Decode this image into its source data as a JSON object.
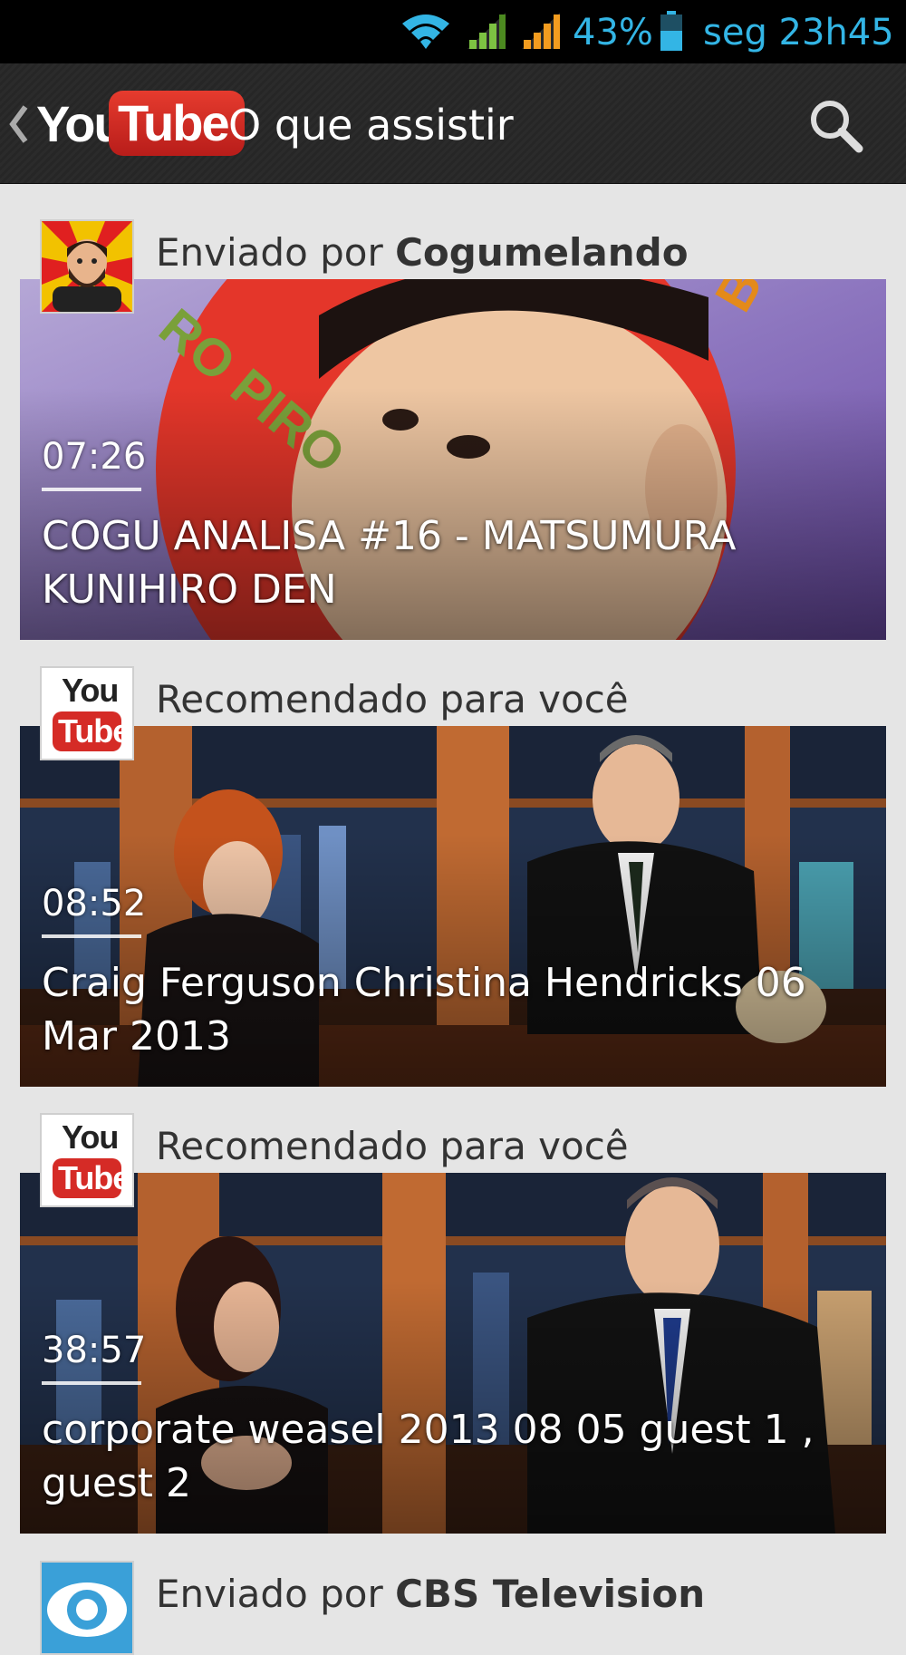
{
  "status_bar": {
    "battery": "43%",
    "time": "seg 23h45",
    "icons": [
      "wifi-icon",
      "signal-icon",
      "signal-icon",
      "battery-icon"
    ],
    "color": "#33b5e5"
  },
  "action_bar": {
    "logo_you": "You",
    "logo_tube": "Tube",
    "title": "O que assistir",
    "icons": [
      "back-chevron-icon",
      "search-icon"
    ]
  },
  "feed": [
    {
      "source_prefix": "Enviado por",
      "source_name": "Cogumelando",
      "avatar": "channel-avatar",
      "duration": "07:26",
      "title": "COGU ANALISA #16 - MATSUMURA KUNIHIRO DEN"
    },
    {
      "source_prefix": "Recomendado para você",
      "source_name": "",
      "avatar": "youtube-logo",
      "avatar_you": "You",
      "avatar_tube": "Tube",
      "duration": "08:52",
      "title": "Craig Ferguson Christina Hendricks 06 Mar 2013"
    },
    {
      "source_prefix": "Recomendado para você",
      "source_name": "",
      "avatar": "youtube-logo",
      "avatar_you": "You",
      "avatar_tube": "Tube",
      "duration": "38:57",
      "title": "corporate weasel 2013 08 05 guest 1 , guest 2"
    },
    {
      "source_prefix": "Enviado por",
      "source_name": "CBS Television",
      "avatar": "cbs-logo"
    }
  ],
  "colors": {
    "youtube_red": "#d52b26",
    "feed_background": "#e5e5e5"
  }
}
